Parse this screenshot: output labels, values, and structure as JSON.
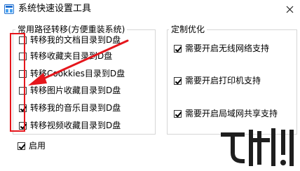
{
  "window": {
    "title": "系统快速设置工具"
  },
  "left_group": {
    "legend": "常用路径转移(方便重装系统)",
    "items": [
      {
        "label": "转移我的文档目录到D盘",
        "checked": false
      },
      {
        "label": "转移收藏夹目录到D盘",
        "checked": false
      },
      {
        "label": "转移Cookkies目录到D盘",
        "checked": false
      },
      {
        "label": "转移图片收藏目录到D盘",
        "checked": false
      },
      {
        "label": "转移我的音乐目录到D盘",
        "checked": true
      },
      {
        "label": "转移视频收藏目录到D盘",
        "checked": true
      }
    ]
  },
  "enable": {
    "label": "启用",
    "checked": true
  },
  "right_group": {
    "legend": "定制优化",
    "items": [
      {
        "label": "需要开启无线网络支持",
        "checked": true
      },
      {
        "label": "需要开启打印机支持",
        "checked": true
      },
      {
        "label": "需要开启局域网共享支持",
        "checked": true
      }
    ]
  },
  "colors": {
    "annotation": "#e5161c",
    "border": "#d6d6d6",
    "icon_blue": "#1f6fd1"
  },
  "icons": {
    "app": "app-icon",
    "close": "close-icon",
    "watermark": "watermark-logo"
  }
}
